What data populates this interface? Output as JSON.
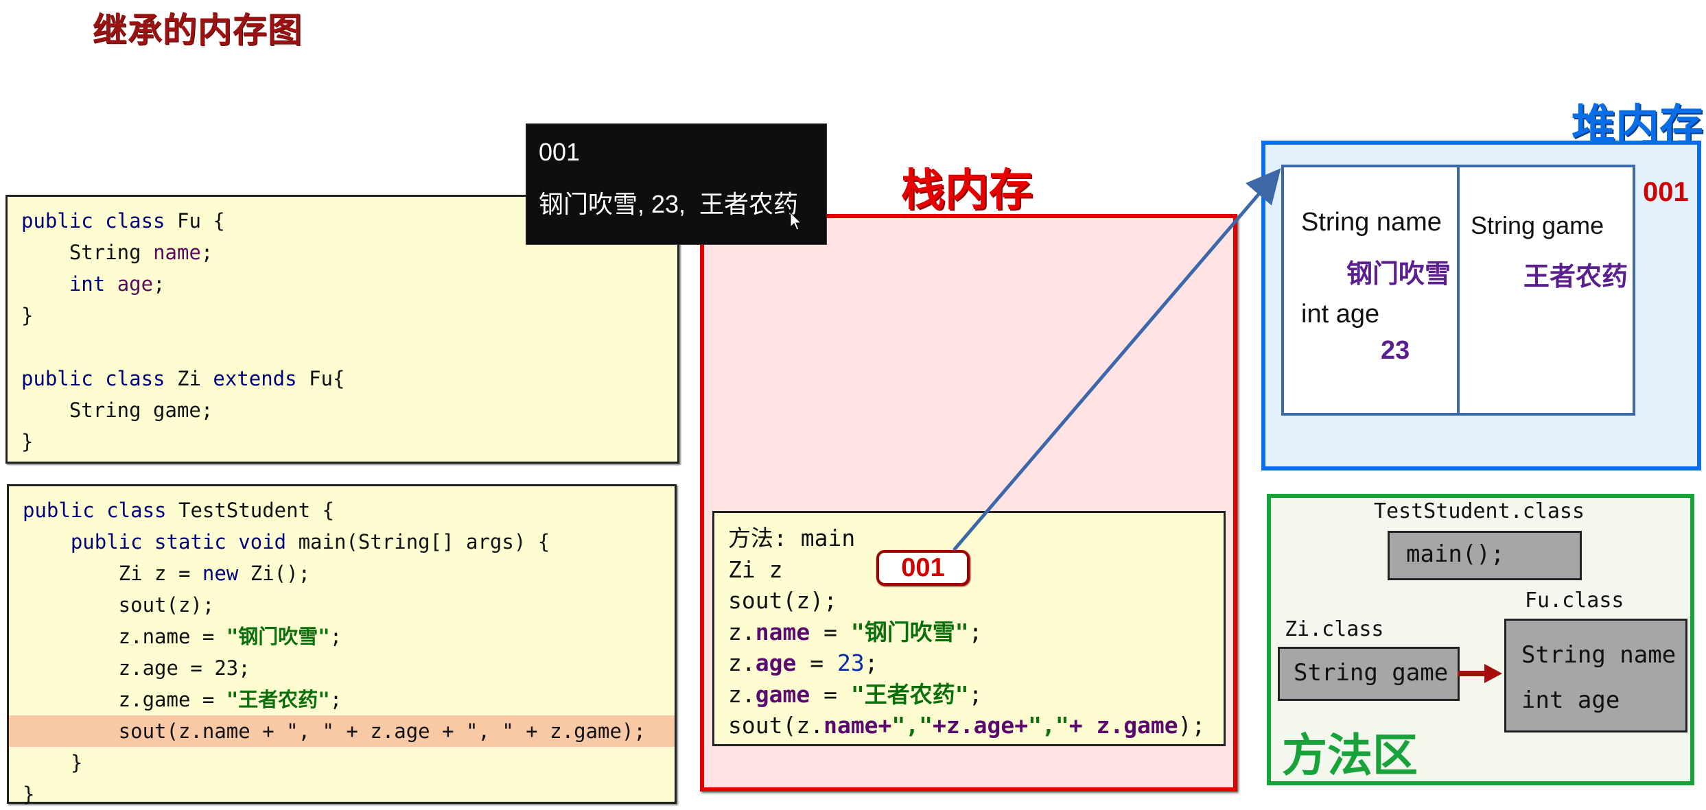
{
  "title": "继承的内存图",
  "code_fu_zi": {
    "lines": [
      [
        {
          "t": "public class ",
          "c": "kw"
        },
        {
          "t": "Fu {",
          "c": ""
        }
      ],
      [
        {
          "t": "    String ",
          "c": ""
        },
        {
          "t": "name",
          "c": "fld"
        },
        {
          "t": ";",
          "c": ""
        }
      ],
      [
        {
          "t": "    int ",
          "c": "kw"
        },
        {
          "t": "age",
          "c": "fld"
        },
        {
          "t": ";",
          "c": ""
        }
      ],
      [
        {
          "t": "}",
          "c": ""
        }
      ],
      [
        {
          "t": "",
          "c": ""
        }
      ],
      [
        {
          "t": "public class ",
          "c": "kw"
        },
        {
          "t": "Zi ",
          "c": ""
        },
        {
          "t": "extends ",
          "c": "kw"
        },
        {
          "t": "Fu{",
          "c": ""
        }
      ],
      [
        {
          "t": "    String game;",
          "c": ""
        }
      ],
      [
        {
          "t": "}",
          "c": ""
        }
      ]
    ]
  },
  "code_test": {
    "highlight_line": 7,
    "lines": [
      [
        {
          "t": "public class ",
          "c": "kw"
        },
        {
          "t": "TestStudent {",
          "c": ""
        }
      ],
      [
        {
          "t": "    public static void ",
          "c": "kw"
        },
        {
          "t": "main(String[] args) {",
          "c": ""
        }
      ],
      [
        {
          "t": "        Zi z = ",
          "c": ""
        },
        {
          "t": "new ",
          "c": "kw"
        },
        {
          "t": "Zi();",
          "c": ""
        }
      ],
      [
        {
          "t": "        sout(z);",
          "c": ""
        }
      ],
      [
        {
          "t": "        z.name = ",
          "c": ""
        },
        {
          "t": "\"钢门吹雪\"",
          "c": "str"
        },
        {
          "t": ";",
          "c": ""
        }
      ],
      [
        {
          "t": "        z.age = 23;",
          "c": ""
        }
      ],
      [
        {
          "t": "        z.game = ",
          "c": ""
        },
        {
          "t": "\"王者农药\"",
          "c": "str"
        },
        {
          "t": ";",
          "c": ""
        }
      ],
      [
        {
          "t": "        sout(z.name + \", \" + z.age + \", \" + z.game);",
          "c": ""
        }
      ],
      [
        {
          "t": "    }",
          "c": ""
        }
      ],
      [
        {
          "t": "}",
          "c": ""
        }
      ]
    ]
  },
  "tooltip": {
    "line1": "001",
    "line2": "钢门吹雪, 23,  王者农药",
    "cursor_icon": "mouse-pointer"
  },
  "stack": {
    "label": "栈内存",
    "frame_lines": [
      [
        {
          "t": "方法: main",
          "c": ""
        }
      ],
      [
        {
          "t": "Zi z",
          "c": ""
        }
      ],
      [
        {
          "t": "sout(z);",
          "c": ""
        }
      ],
      [
        {
          "t": "z.",
          "c": ""
        },
        {
          "t": "name",
          "c": "fld"
        },
        {
          "t": " = ",
          "c": ""
        },
        {
          "t": "\"钢门吹雪\"",
          "c": "str"
        },
        {
          "t": ";",
          "c": ""
        }
      ],
      [
        {
          "t": "z.",
          "c": ""
        },
        {
          "t": "age",
          "c": "fld"
        },
        {
          "t": " = ",
          "c": ""
        },
        {
          "t": "23",
          "c": "num"
        },
        {
          "t": ";",
          "c": ""
        }
      ],
      [
        {
          "t": "z.",
          "c": ""
        },
        {
          "t": "game",
          "c": "fld"
        },
        {
          "t": " = ",
          "c": ""
        },
        {
          "t": "\"王者农药\"",
          "c": "str"
        },
        {
          "t": ";",
          "c": ""
        }
      ],
      [
        {
          "t": "sout(z.",
          "c": ""
        },
        {
          "t": "name+",
          "c": "fld"
        },
        {
          "t": "\",\"",
          "c": "str"
        },
        {
          "t": "+z.age+",
          "c": "fld"
        },
        {
          "t": "\",\"",
          "c": "str"
        },
        {
          "t": "+ z.game",
          "c": "fld"
        },
        {
          "t": ");",
          "c": ""
        }
      ]
    ],
    "reference_value": "001"
  },
  "heap": {
    "label": "堆内存",
    "address": "001",
    "parent_part": {
      "field1_decl": "String name",
      "field1_value": "钢门吹雪",
      "field2_decl": "int age",
      "field2_value": "23"
    },
    "child_part": {
      "field_decl": "String game",
      "field_value": "王者农药"
    }
  },
  "method_area": {
    "label": "方法区",
    "test_class": {
      "name": "TestStudent.class",
      "member": "main();"
    },
    "zi_class": {
      "name": "Zi.class",
      "member": "String game"
    },
    "fu_class": {
      "name": "Fu.class",
      "members": [
        "String name",
        "int age"
      ]
    },
    "inherits_arrow_icon": "arrow-right"
  },
  "colors": {
    "title": "#9b1212",
    "stack": "#e00000",
    "heap": "#0a6ee8",
    "method_area": "#17a33a",
    "reference_arrow": "#3c68a8"
  }
}
